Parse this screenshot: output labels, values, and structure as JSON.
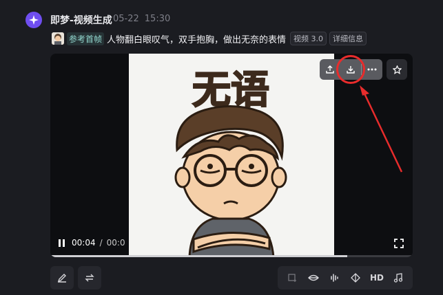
{
  "header": {
    "app_name": "即梦-视频生成",
    "date": "05-22",
    "time": "15:30"
  },
  "prompt": {
    "reference_label": "参考首帧",
    "text": "人物翻白眼叹气，双手抱胸，做出无奈的表情",
    "tags": [
      "视频 3.0",
      "详细信息"
    ]
  },
  "video": {
    "frame_caption": "无语",
    "current_time": "00:04",
    "time_separator": "/",
    "total_time_visible": "00:0",
    "progress_fraction": 0.82
  },
  "overlay_toolbar": {
    "icons": [
      "share-icon",
      "download-icon",
      "more-icon",
      "star-icon"
    ]
  },
  "bottom_toolbar": {
    "left_icons": [
      "edit-icon",
      "regenerate-icon"
    ],
    "actions": [
      "frame-icon",
      "lip-sync-icon",
      "audio-wave-icon",
      "transition-icon",
      "hd",
      "music-icon"
    ],
    "hd_label": "HD"
  },
  "annotation": {
    "color": "#e82c2c"
  }
}
